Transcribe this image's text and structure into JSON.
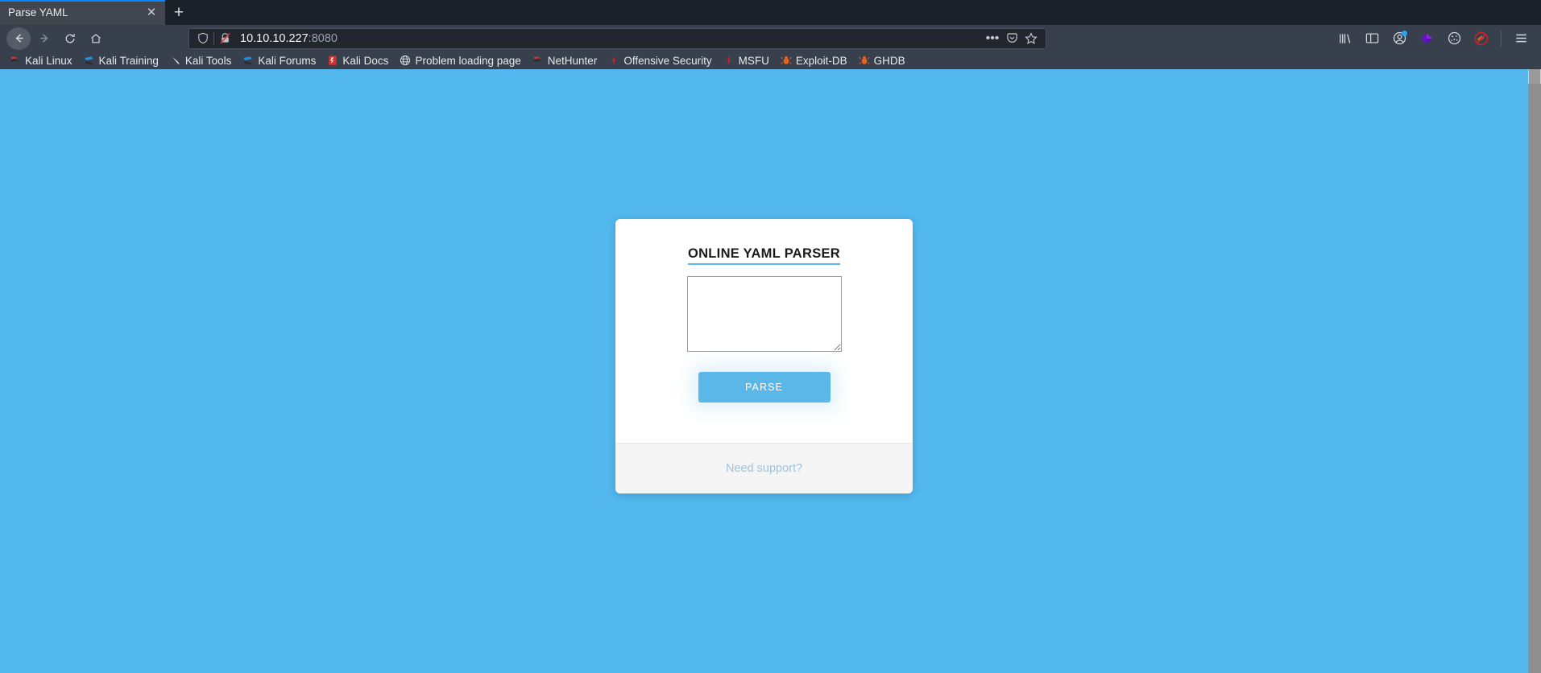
{
  "browser": {
    "tab": {
      "title": "Parse YAML",
      "close_label": "✕"
    },
    "new_tab_label": "+",
    "nav": {
      "back": "back-arrow",
      "forward": "forward-arrow",
      "reload": "reload",
      "home": "home"
    },
    "url": {
      "host": "10.10.10.227",
      "port": ":8080",
      "shield_icon": "tracking-protection-shield",
      "insecure_icon": "broken-lock",
      "more_label": "•••",
      "pocket_icon": "pocket",
      "bookmark_icon": "star"
    },
    "toolbar_right": [
      {
        "name": "library-icon"
      },
      {
        "name": "sidebar-icon"
      },
      {
        "name": "account-icon"
      },
      {
        "name": "containers-icon"
      },
      {
        "name": "cookie-icon"
      },
      {
        "name": "blocked-icon"
      },
      {
        "name": "menu-icon"
      }
    ],
    "bookmarks": [
      {
        "label": "Kali Linux",
        "icon": "kali-dragon"
      },
      {
        "label": "Kali Training",
        "icon": "kali-training"
      },
      {
        "label": "Kali Tools",
        "icon": "kali-tools"
      },
      {
        "label": "Kali Forums",
        "icon": "kali-forums"
      },
      {
        "label": "Kali Docs",
        "icon": "kali-docs"
      },
      {
        "label": "Problem loading page",
        "icon": "globe"
      },
      {
        "label": "NetHunter",
        "icon": "nethunter"
      },
      {
        "label": "Offensive Security",
        "icon": "offensive-security"
      },
      {
        "label": "MSFU",
        "icon": "msfu"
      },
      {
        "label": "Exploit-DB",
        "icon": "exploit-db"
      },
      {
        "label": "GHDB",
        "icon": "ghdb"
      }
    ]
  },
  "page": {
    "background_color": "#52b8ee",
    "card": {
      "title": "ONLINE YAML PARSER",
      "accent_color": "#5bb7e8",
      "textarea": {
        "value": "",
        "placeholder": ""
      },
      "parse_button_label": "PARSE",
      "footer_link_label": "Need support?"
    }
  }
}
